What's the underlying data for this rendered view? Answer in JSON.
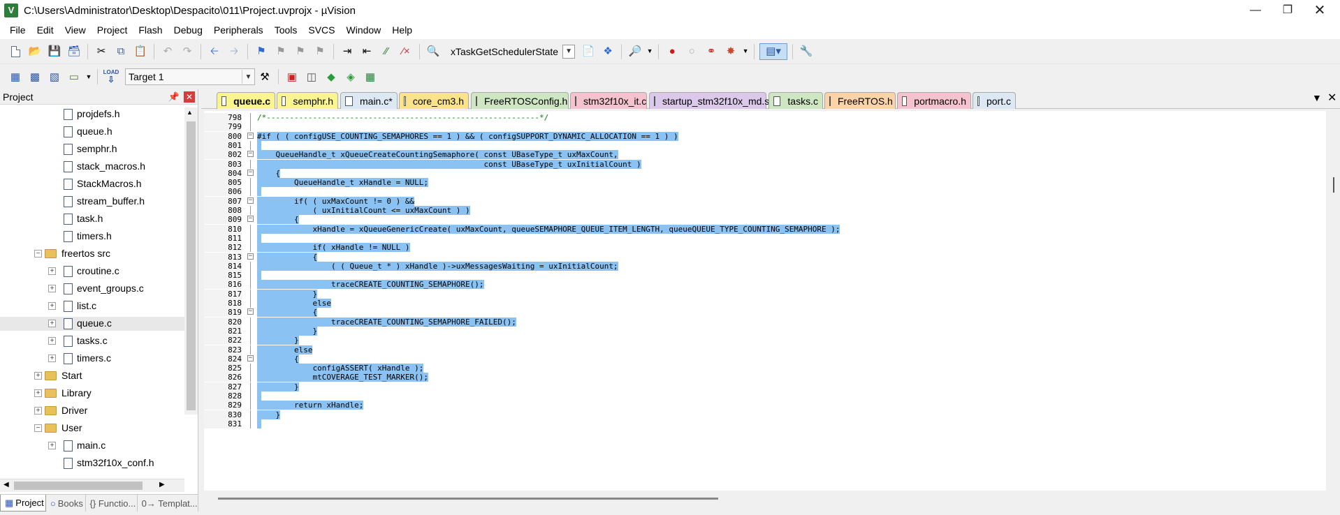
{
  "window": {
    "title": "C:\\Users\\Administrator\\Desktop\\Despacito\\011\\Project.uvprojx - µVision",
    "icon_letter": "V"
  },
  "menu": [
    "File",
    "Edit",
    "View",
    "Project",
    "Flash",
    "Debug",
    "Peripherals",
    "Tools",
    "SVCS",
    "Window",
    "Help"
  ],
  "toolbar1": {
    "function_combo": "xTaskGetSchedulerState"
  },
  "toolbar2": {
    "target_combo": "Target 1",
    "load_label": "LOAD"
  },
  "project_panel": {
    "title": "Project",
    "tree": [
      {
        "label": "projdefs.h",
        "type": "file"
      },
      {
        "label": "queue.h",
        "type": "file"
      },
      {
        "label": "semphr.h",
        "type": "file"
      },
      {
        "label": "stack_macros.h",
        "type": "file"
      },
      {
        "label": "StackMacros.h",
        "type": "file"
      },
      {
        "label": "stream_buffer.h",
        "type": "file"
      },
      {
        "label": "task.h",
        "type": "file"
      },
      {
        "label": "timers.h",
        "type": "file"
      },
      {
        "label": "freertos src",
        "type": "folder-open"
      },
      {
        "label": "croutine.c",
        "type": "cfile"
      },
      {
        "label": "event_groups.c",
        "type": "cfile"
      },
      {
        "label": "list.c",
        "type": "cfile"
      },
      {
        "label": "queue.c",
        "type": "cfile",
        "selected": true
      },
      {
        "label": "tasks.c",
        "type": "cfile"
      },
      {
        "label": "timers.c",
        "type": "cfile"
      },
      {
        "label": "Start",
        "type": "folder"
      },
      {
        "label": "Library",
        "type": "folder"
      },
      {
        "label": "Driver",
        "type": "folder"
      },
      {
        "label": "User",
        "type": "folder-open"
      },
      {
        "label": "main.c",
        "type": "cfile"
      },
      {
        "label": "stm32f10x_conf.h",
        "type": "file"
      }
    ],
    "bottom_tabs": [
      "Project",
      "Books",
      "{} Functio...",
      "0→ Templat..."
    ]
  },
  "editor": {
    "tabs": [
      {
        "label": "queue.c",
        "color": "#fbf58f",
        "active": true
      },
      {
        "label": "semphr.h",
        "color": "#fbf58f"
      },
      {
        "label": "main.c*",
        "color": "#dde8f5"
      },
      {
        "label": "core_cm3.h",
        "color": "#fbe38a"
      },
      {
        "label": "FreeRTOSConfig.h",
        "color": "#cfe6c2"
      },
      {
        "label": "stm32f10x_it.c",
        "color": "#f4c3cf"
      },
      {
        "label": "startup_stm32f10x_md.s",
        "color": "#dcc8ea"
      },
      {
        "label": "tasks.c",
        "color": "#cfe6c2"
      },
      {
        "label": "FreeRTOS.h",
        "color": "#fbd3a8"
      },
      {
        "label": "portmacro.h",
        "color": "#f4c3cf"
      },
      {
        "label": "port.c",
        "color": "#dde8f5"
      }
    ],
    "lines": [
      {
        "n": "798",
        "t": "/*-----------------------------------------------------------*/",
        "kind": "comment",
        "fold": "line"
      },
      {
        "n": "799",
        "t": "",
        "kind": "plain",
        "fold": "line"
      },
      {
        "n": "800",
        "t": "#if ( ( configUSE_COUNTING_SEMAPHORES == 1 ) && ( configSUPPORT_DYNAMIC_ALLOCATION == 1 ) )",
        "kind": "hl",
        "fold": "box"
      },
      {
        "n": "801",
        "t": "",
        "kind": "hl",
        "fold": "line"
      },
      {
        "n": "802",
        "t": "    QueueHandle_t xQueueCreateCountingSemaphore( const UBaseType_t uxMaxCount,",
        "kind": "hl",
        "fold": "box"
      },
      {
        "n": "803",
        "t": "                                                 const UBaseType_t uxInitialCount )",
        "kind": "hl",
        "fold": "line"
      },
      {
        "n": "804",
        "t": "    {",
        "kind": "hl",
        "fold": "box"
      },
      {
        "n": "805",
        "t": "        QueueHandle_t xHandle = NULL;",
        "kind": "hl",
        "fold": "line"
      },
      {
        "n": "806",
        "t": "",
        "kind": "hl",
        "fold": "line"
      },
      {
        "n": "807",
        "t": "        if( ( uxMaxCount != 0 ) &&",
        "kind": "hl",
        "fold": "box"
      },
      {
        "n": "808",
        "t": "            ( uxInitialCount <= uxMaxCount ) )",
        "kind": "hl",
        "fold": "line"
      },
      {
        "n": "809",
        "t": "        {",
        "kind": "hl",
        "fold": "box"
      },
      {
        "n": "810",
        "t": "            xHandle = xQueueGenericCreate( uxMaxCount, queueSEMAPHORE_QUEUE_ITEM_LENGTH, queueQUEUE_TYPE_COUNTING_SEMAPHORE );",
        "kind": "hl",
        "fold": "line"
      },
      {
        "n": "811",
        "t": "",
        "kind": "hl",
        "fold": "line"
      },
      {
        "n": "812",
        "t": "            if( xHandle != NULL )",
        "kind": "hl",
        "fold": "line"
      },
      {
        "n": "813",
        "t": "            {",
        "kind": "hl",
        "fold": "box"
      },
      {
        "n": "814",
        "t": "                ( ( Queue_t * ) xHandle )->uxMessagesWaiting = uxInitialCount;",
        "kind": "hl",
        "fold": "line"
      },
      {
        "n": "815",
        "t": "",
        "kind": "hl",
        "fold": "line"
      },
      {
        "n": "816",
        "t": "                traceCREATE_COUNTING_SEMAPHORE();",
        "kind": "hl",
        "fold": "line"
      },
      {
        "n": "817",
        "t": "            }",
        "kind": "hl",
        "fold": "line"
      },
      {
        "n": "818",
        "t": "            else",
        "kind": "hl",
        "fold": "line"
      },
      {
        "n": "819",
        "t": "            {",
        "kind": "hl",
        "fold": "box"
      },
      {
        "n": "820",
        "t": "                traceCREATE_COUNTING_SEMAPHORE_FAILED();",
        "kind": "hl",
        "fold": "line"
      },
      {
        "n": "821",
        "t": "            }",
        "kind": "hl",
        "fold": "line"
      },
      {
        "n": "822",
        "t": "        }",
        "kind": "hl",
        "fold": "line"
      },
      {
        "n": "823",
        "t": "        else",
        "kind": "hl",
        "fold": "line"
      },
      {
        "n": "824",
        "t": "        {",
        "kind": "hl",
        "fold": "box"
      },
      {
        "n": "825",
        "t": "            configASSERT( xHandle );",
        "kind": "hl",
        "fold": "line"
      },
      {
        "n": "826",
        "t": "            mtCOVERAGE_TEST_MARKER();",
        "kind": "hl",
        "fold": "line"
      },
      {
        "n": "827",
        "t": "        }",
        "kind": "hl",
        "fold": "line"
      },
      {
        "n": "828",
        "t": "",
        "kind": "hl",
        "fold": "line"
      },
      {
        "n": "829",
        "t": "        return xHandle;",
        "kind": "hl",
        "fold": "line"
      },
      {
        "n": "830",
        "t": "    }",
        "kind": "hl",
        "fold": "line"
      },
      {
        "n": "831",
        "t": "",
        "kind": "hl",
        "fold": "line"
      }
    ]
  }
}
